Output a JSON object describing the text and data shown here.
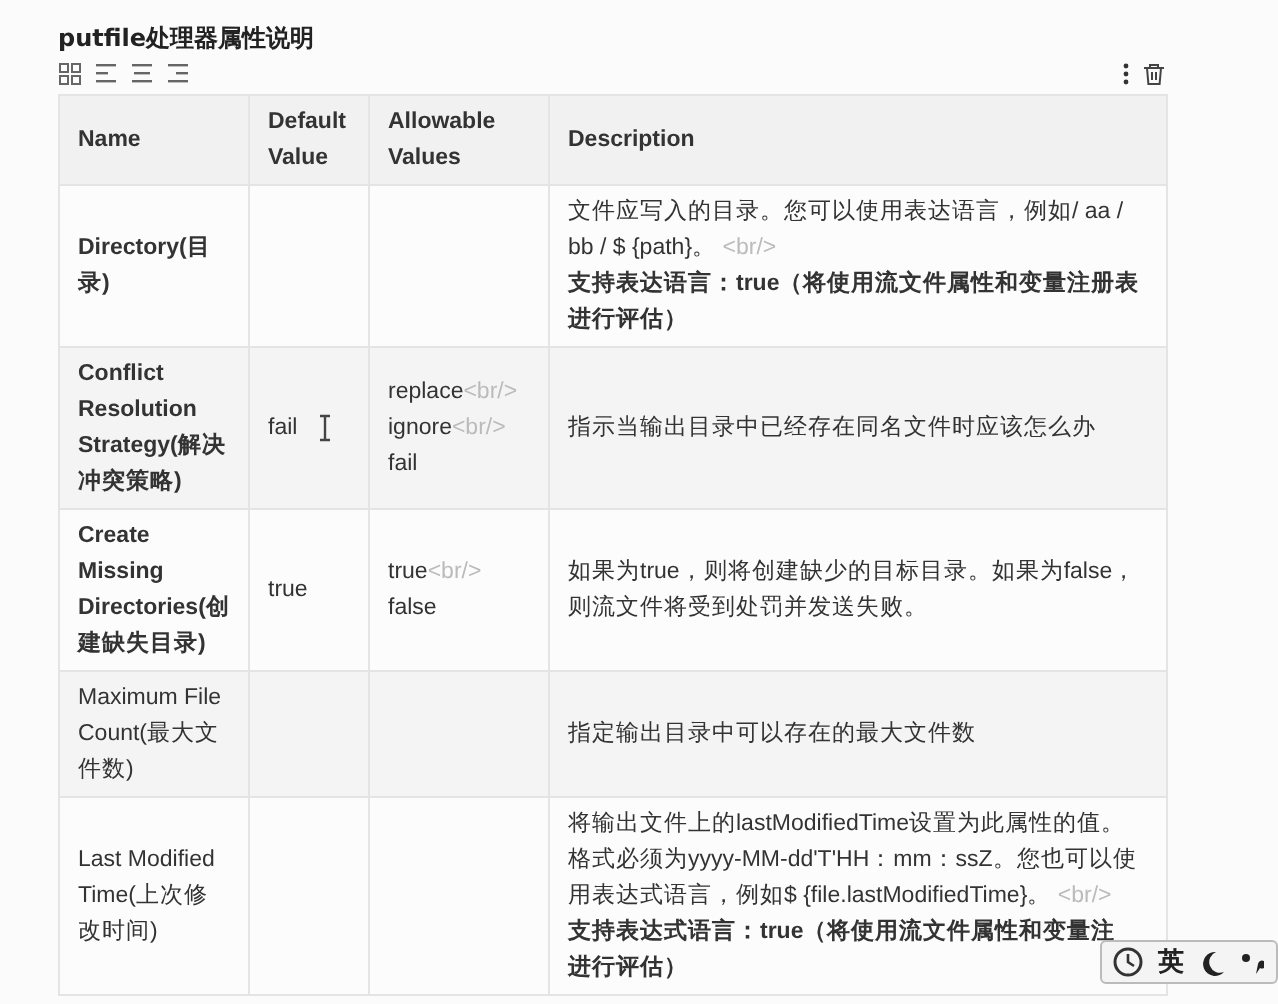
{
  "title": "putfile处理器属性说明",
  "table": {
    "columns": [
      "Name",
      "Default Value",
      "Allowable Values",
      "Description"
    ],
    "rows": [
      {
        "name": "Directory(目录)",
        "name_bold": true,
        "default": "",
        "cursor": false,
        "allowable": [],
        "description": [
          {
            "kind": "plain",
            "text": "文件应写入的目录。您可以使用表达语言，例如/ aa / bb / $ {path}。",
            "tag": "<br/>"
          },
          {
            "kind": "strong",
            "text": "支持表达语言：true（将使用流文件属性和变量注册表进行评估）"
          }
        ]
      },
      {
        "name": "Conflict Resolution Strategy(解决冲突策略)",
        "name_bold": true,
        "default": "fail",
        "cursor": true,
        "allowable": [
          {
            "text": "replace",
            "tag": "<br/>"
          },
          {
            "text": "ignore",
            "tag": "<br/>"
          },
          {
            "text": "fail"
          }
        ],
        "description": [
          {
            "kind": "plain",
            "text": "指示当输出目录中已经存在同名文件时应该怎么办"
          }
        ]
      },
      {
        "name": "Create Missing Directories(创建缺失目录)",
        "name_bold": true,
        "default": "true",
        "cursor": false,
        "allowable": [
          {
            "text": "true",
            "tag": "<br/>"
          },
          {
            "text": "false"
          }
        ],
        "description": [
          {
            "kind": "plain",
            "text": "如果为true，则将创建缺少的目标目录。如果为false，则流文件将受到处罚并发送失败。"
          }
        ]
      },
      {
        "name": "Maximum File Count(最大文件数)",
        "name_bold": false,
        "default": "",
        "cursor": false,
        "allowable": [],
        "description": [
          {
            "kind": "plain",
            "text": "指定输出目录中可以存在的最大文件数"
          }
        ]
      },
      {
        "name": "Last Modified Time(上次修改时间)",
        "name_bold": false,
        "default": "",
        "cursor": false,
        "allowable": [],
        "description": [
          {
            "kind": "plain",
            "text": "将输出文件上的lastModifiedTime设置为此属性的值。格式必须为yyyy-MM-dd'T'HH：mm：ssZ。您也可以使用表达式语言，例如$ {file.lastModifiedTime}。",
            "tag": "<br/>"
          },
          {
            "kind": "strong",
            "text": "支持表达式语言：true（将使用流文件属性和变量注"
          },
          {
            "kind": "strong",
            "text": "进行评估）"
          }
        ]
      }
    ]
  },
  "ime": {
    "label": "英"
  }
}
